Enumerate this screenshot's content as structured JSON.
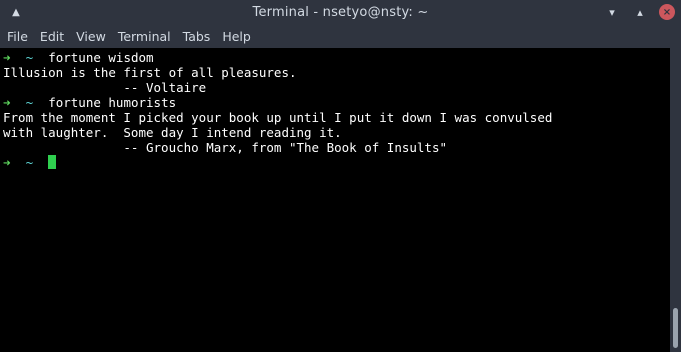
{
  "window": {
    "title": "Terminal - nsetyo@nsty: ~",
    "controls": {
      "minimize": "▾",
      "maximize": "▴",
      "close": "×"
    },
    "app_icon": "▲"
  },
  "menubar": {
    "items": [
      "File",
      "Edit",
      "View",
      "Terminal",
      "Tabs",
      "Help"
    ]
  },
  "terminal": {
    "prompt_arrow": "➜",
    "prompt_dir": "~",
    "lines": [
      {
        "type": "prompt",
        "command": "fortune wisdom"
      },
      {
        "type": "output",
        "text": "Illusion is the first of all pleasures."
      },
      {
        "type": "output",
        "text": "                -- Voltaire"
      },
      {
        "type": "prompt",
        "command": "fortune humorists"
      },
      {
        "type": "output",
        "text": "From the moment I picked your book up until I put it down I was convulsed"
      },
      {
        "type": "output",
        "text": "with laughter.  Some day I intend reading it."
      },
      {
        "type": "output",
        "text": "                -- Groucho Marx, from \"The Book of Insults\""
      },
      {
        "type": "prompt",
        "command": ""
      }
    ]
  },
  "colors": {
    "titlebar": "#2f343f",
    "prompt_arrow": "#5fd75f",
    "prompt_dir": "#5fd7d7",
    "cursor": "#2fcf4f"
  }
}
